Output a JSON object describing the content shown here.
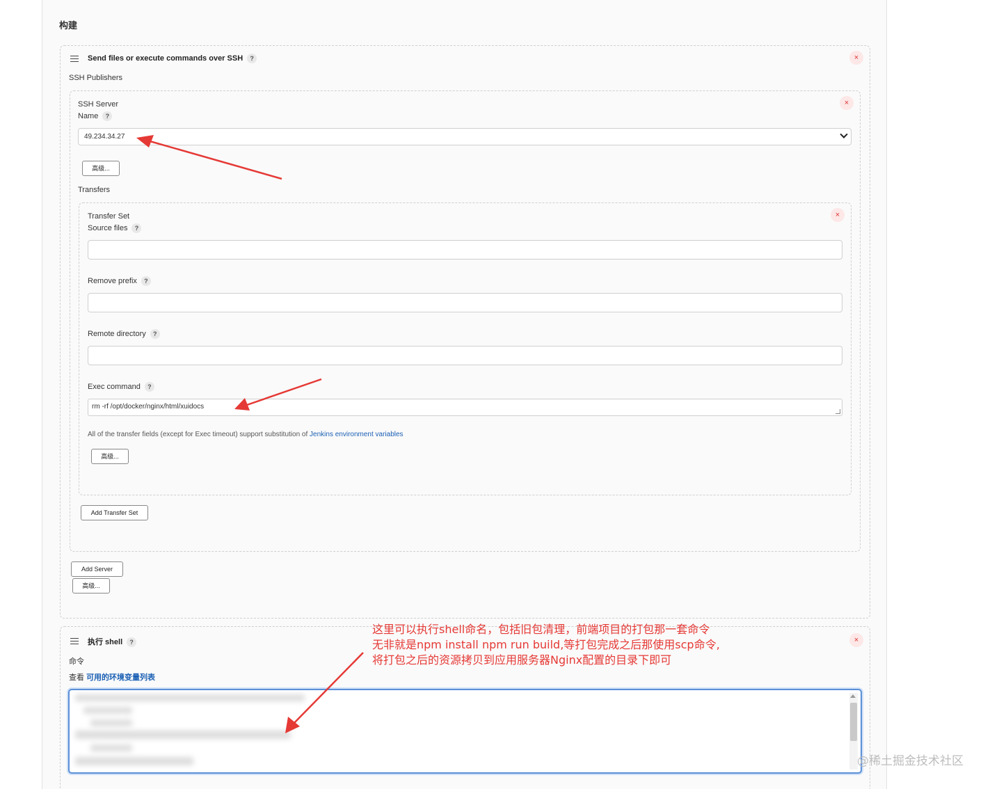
{
  "section": {
    "title": "构建"
  },
  "ssh_step": {
    "title": "Send files or execute commands over SSH",
    "publishers_label": "SSH Publishers",
    "server": {
      "heading": "SSH Server",
      "name_label": "Name",
      "name_value": "49.234.34.27",
      "advanced_label": "高级..."
    },
    "transfers_label": "Transfers",
    "transfer_set": {
      "heading": "Transfer Set",
      "source_files_label": "Source files",
      "source_files_value": "",
      "remove_prefix_label": "Remove prefix",
      "remove_prefix_value": "",
      "remote_directory_label": "Remote directory",
      "remote_directory_value": "",
      "exec_command_label": "Exec command",
      "exec_command_value": "rm -rf /opt/docker/nginx/html/xuidocs",
      "hint_prefix": "All of the transfer fields (except for Exec timeout) support substitution of ",
      "hint_link": "Jenkins environment variables",
      "advanced_label": "高级..."
    },
    "add_transfer_set_label": "Add Transfer Set",
    "add_server_label": "Add Server",
    "advanced_label": "高级..."
  },
  "shell_step": {
    "title": "执行 shell",
    "command_label": "命令",
    "env_prefix": "查看 ",
    "env_link": "可用的环境变量列表"
  },
  "annotation": {
    "line1": "这里可以执行shell命名，包括旧包清理，前端项目的打包那一套命令",
    "line2": "无非就是npm install  npm run build,等打包完成之后那使用scp命令,",
    "line3": "将打包之后的资源拷贝到应用服务器Nginx配置的目录下即可"
  },
  "icons": {
    "help": "?",
    "close": "×"
  },
  "watermark": "@稀土掘金技术社区",
  "colors": {
    "annotation": "#e53935",
    "link": "#1a5fb4",
    "close_bg": "#fde7e7",
    "focus_border": "#5b8fd6"
  }
}
